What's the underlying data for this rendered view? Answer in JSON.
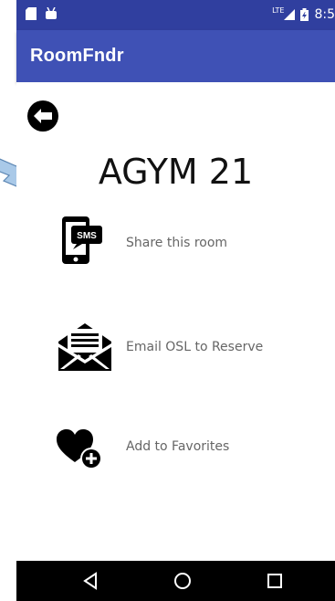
{
  "status_bar": {
    "network": "LTE",
    "time": "8:5"
  },
  "app_bar": {
    "title": "RoomFndr"
  },
  "room": {
    "name": "AGYM 21"
  },
  "actions": [
    {
      "label": "Share this room",
      "icon": "sms-phone-icon"
    },
    {
      "label": "Email OSL to Reserve",
      "icon": "envelope-icon"
    },
    {
      "label": "Add to Favorites",
      "icon": "heart-plus-icon"
    }
  ],
  "nav": {
    "icons": [
      "back-triangle-icon",
      "home-circle-icon",
      "recents-square-icon"
    ]
  },
  "colors": {
    "status_bar": "#303f9f",
    "app_bar": "#3f51b5",
    "nav_bar": "#000000"
  }
}
